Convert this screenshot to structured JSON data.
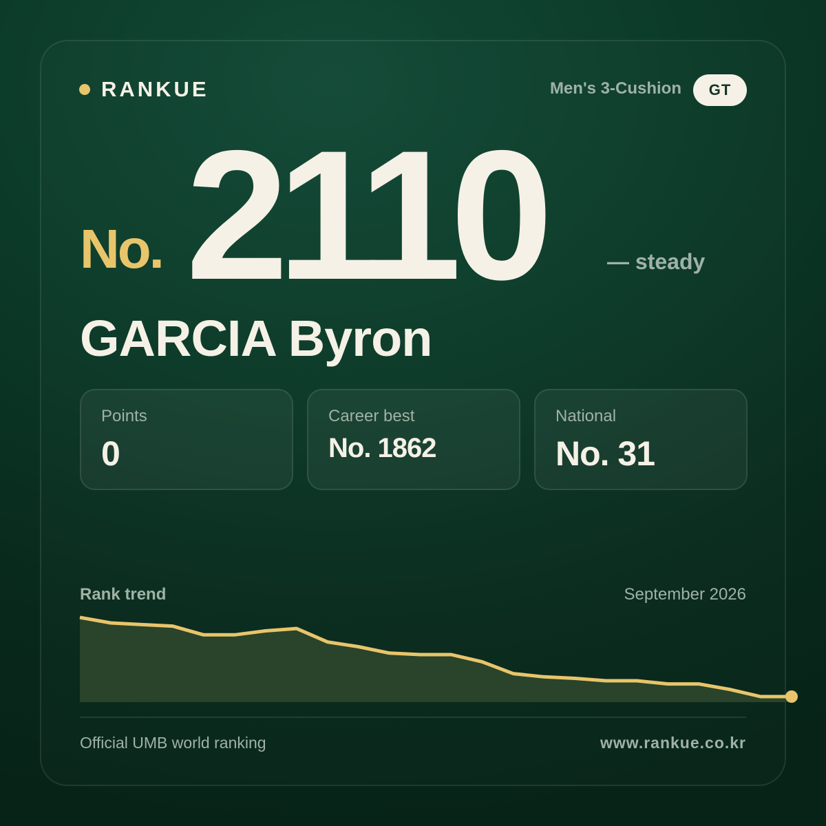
{
  "brand": {
    "name": "RANKUE",
    "accent_color": "#e8c56b"
  },
  "category": "Men's 3-Cushion",
  "country_code": "GT",
  "rank": {
    "prefix": "No.",
    "value": "2110",
    "change": "— steady"
  },
  "player": {
    "name": "GARCIA Byron"
  },
  "stats": [
    {
      "label": "Points",
      "value": "0"
    },
    {
      "label": "Career best",
      "value": "No. 1862"
    },
    {
      "label": "National",
      "value": "No. 31"
    }
  ],
  "trend": {
    "title": "Rank trend",
    "date": "September 2026"
  },
  "chart_data": {
    "type": "area",
    "values": [
      1,
      0.93,
      0.91,
      0.89,
      0.78,
      0.78,
      0.83,
      0.86,
      0.69,
      0.63,
      0.55,
      0.53,
      0.53,
      0.44,
      0.29,
      0.25,
      0.23,
      0.2,
      0.2,
      0.16,
      0.16,
      0.09,
      0.0,
      0.0
    ],
    "line_color": "#e8c56b",
    "fill_color": "#2a432b",
    "grid": false
  },
  "footer": {
    "left": "Official UMB world ranking",
    "right": "www.rankue.co.kr"
  }
}
